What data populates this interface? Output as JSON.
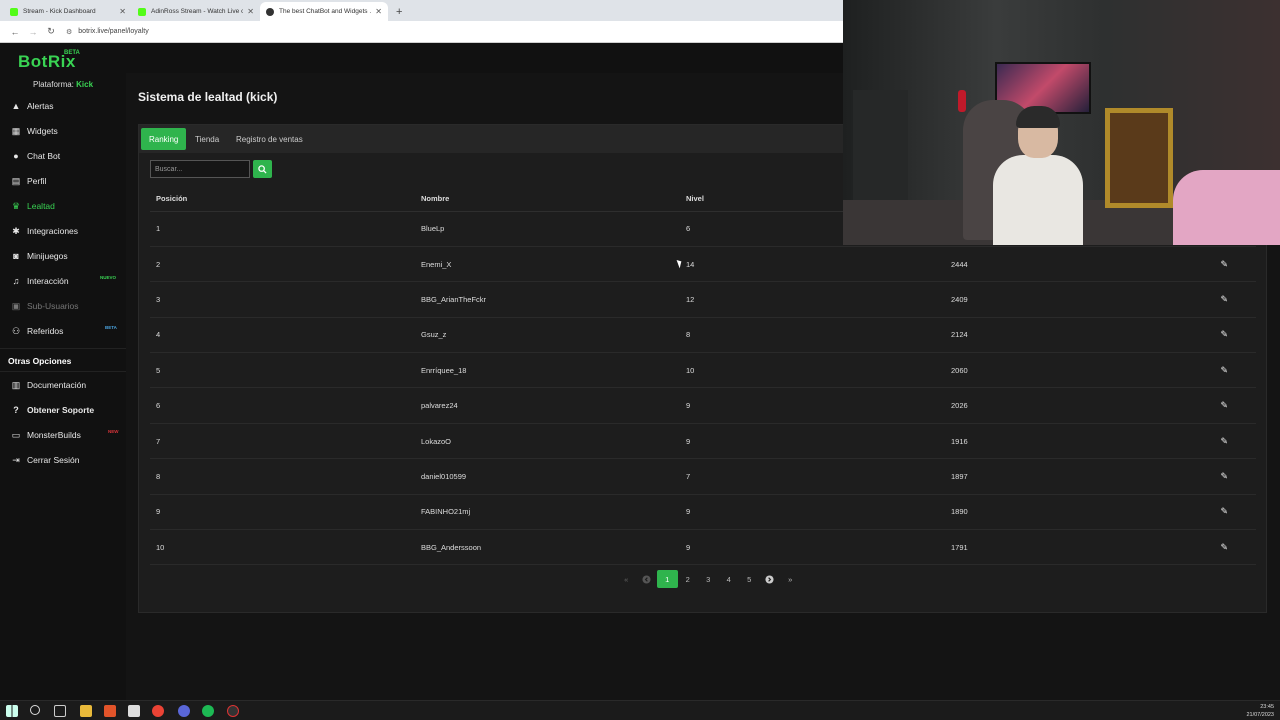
{
  "browser": {
    "tabs": [
      {
        "title": "Stream - Kick Dashboard",
        "color": "#53fc18"
      },
      {
        "title": "AdinRoss Stream - Watch Live o...",
        "color": "#53fc18"
      },
      {
        "title": "The best ChatBot and Widgets ...",
        "color": "#333333"
      }
    ],
    "new_tab": "+",
    "url": "botrix.live/panel/loyalty"
  },
  "brand": {
    "logo": "BotRix",
    "beta": "BETA",
    "platform_label": "Plataforma:",
    "platform_value": "Kick"
  },
  "sidebar": {
    "items": [
      {
        "label": "Alertas",
        "icon": "warning-icon"
      },
      {
        "label": "Widgets",
        "icon": "grid-icon"
      },
      {
        "label": "Chat Bot",
        "icon": "chat-icon"
      },
      {
        "label": "Perfil",
        "icon": "id-card-icon"
      },
      {
        "label": "Lealtad",
        "icon": "trophy-icon"
      },
      {
        "label": "Integraciones",
        "icon": "settings-icon"
      },
      {
        "label": "Minijuegos",
        "icon": "gamepad-icon"
      },
      {
        "label": "Interacción",
        "icon": "music-icon",
        "badge": "NUEVO"
      },
      {
        "label": "Sub-Usuarios",
        "icon": "lock-icon"
      },
      {
        "label": "Referidos",
        "icon": "users-icon",
        "badge": "BETA"
      }
    ],
    "other_title": "Otras Opciones",
    "other_items": [
      {
        "label": "Documentación",
        "icon": "book-icon"
      },
      {
        "label": "Obtener Soporte",
        "icon": "question-icon"
      },
      {
        "label": "MonsterBuilds",
        "icon": "monitor-icon",
        "badge": "NEW"
      },
      {
        "label": "Cerrar Sesión",
        "icon": "logout-icon"
      }
    ],
    "badge_colors": {
      "nuevo": "#39d353",
      "beta": "#4aa3df",
      "new": "#d9343a"
    }
  },
  "page": {
    "title": "Sistema de lealtad (kick)"
  },
  "tabs": [
    "Ranking",
    "Tienda",
    "Registro de ventas"
  ],
  "search": {
    "placeholder": "Buscar..."
  },
  "table": {
    "headers": [
      "Posición",
      "Nombre",
      "Nivel",
      ""
    ],
    "rows": [
      [
        "1",
        "BlueLp",
        "6",
        ""
      ],
      [
        "2",
        "Enemi_X",
        "14",
        "2444"
      ],
      [
        "3",
        "BBG_ArianTheFckr",
        "12",
        "2409"
      ],
      [
        "4",
        "Gsuz_z",
        "8",
        "2124"
      ],
      [
        "5",
        "Enrríquee_18",
        "10",
        "2060"
      ],
      [
        "6",
        "palvarez24",
        "9",
        "2026"
      ],
      [
        "7",
        "LokazoO",
        "9",
        "1916"
      ],
      [
        "8",
        "daniel010599",
        "7",
        "1897"
      ],
      [
        "9",
        "FABINHO21mj",
        "9",
        "1890"
      ],
      [
        "10",
        "BBG_Anderssoon",
        "9",
        "1791"
      ]
    ]
  },
  "pagination": {
    "first": "«",
    "prev": "‹",
    "pages": [
      "1",
      "2",
      "3",
      "4",
      "5"
    ],
    "current": "1",
    "next": "›",
    "last": "»"
  },
  "taskbar": {
    "time": "23:45",
    "date": "21/07/2023"
  },
  "colors": {
    "accent": "#2fb44d",
    "bg": "#141414",
    "panel": "#1d1d1d"
  }
}
